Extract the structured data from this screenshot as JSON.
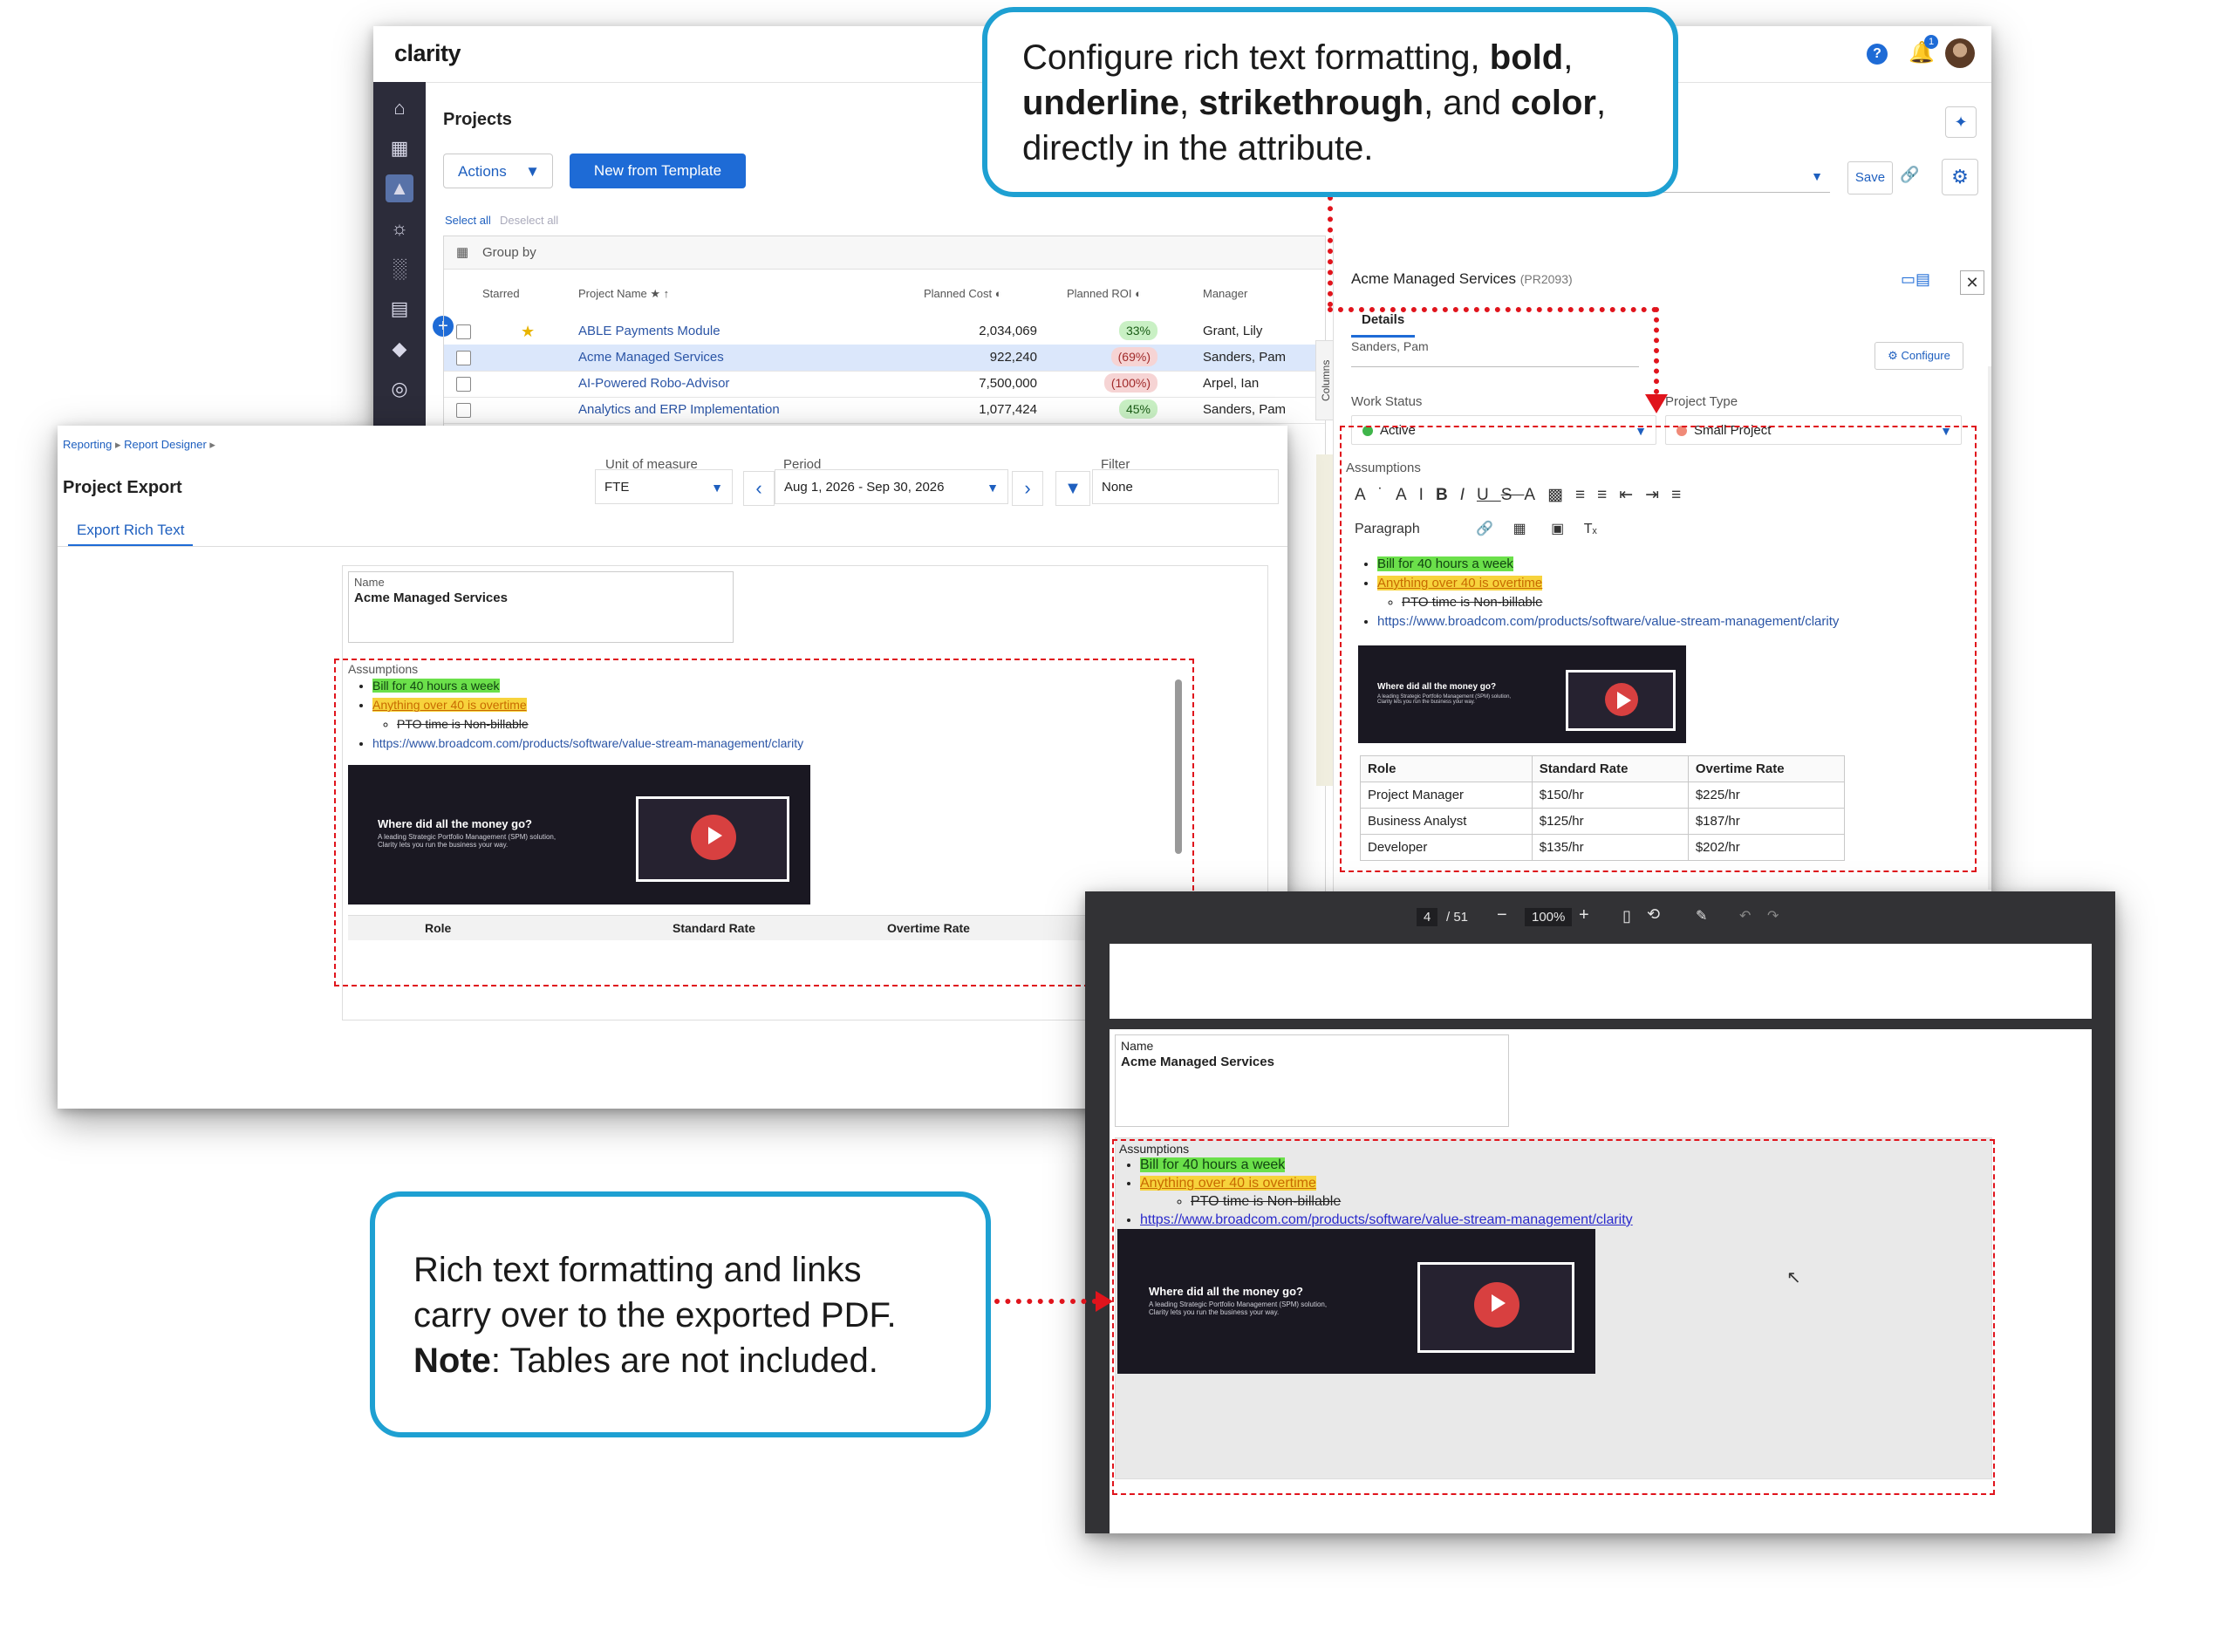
{
  "clarity": {
    "logo": "clarity",
    "page_title": "Projects",
    "actions_label": "Actions",
    "new_from_template_label": "New from Template",
    "select_all": "Select all",
    "deselect_all": "Deselect all",
    "group_by": "Group by",
    "columns_tab": "Columns",
    "save_label": "Save",
    "notification_count": "1",
    "headers": {
      "starred": "Starred",
      "project_name": "Project Name",
      "planned_cost": "Planned Cost",
      "planned_roi": "Planned ROI",
      "manager": "Manager"
    },
    "rows": [
      {
        "starred": true,
        "name": "ABLE Payments Module",
        "cost": "2,034,069",
        "roi": "33%",
        "roi_status": "good",
        "manager": "Grant, Lily"
      },
      {
        "starred": false,
        "name": "Acme Managed Services",
        "cost": "922,240",
        "roi": "(69%)",
        "roi_status": "bad",
        "manager": "Sanders, Pam"
      },
      {
        "starred": false,
        "name": "AI-Powered Robo-Advisor",
        "cost": "7,500,000",
        "roi": "(100%)",
        "roi_status": "bad",
        "manager": "Arpel, Ian"
      },
      {
        "starred": false,
        "name": "Analytics and ERP Implementation",
        "cost": "1,077,424",
        "roi": "45%",
        "roi_status": "good",
        "manager": "Sanders, Pam"
      }
    ],
    "detail": {
      "title": "Acme Managed Services",
      "code": "(PR2093)",
      "tab": "Details",
      "configure": "Configure",
      "truncated_value": "Sanders, Pam",
      "work_status_label": "Work Status",
      "work_status_value": "Active",
      "project_type_label": "Project Type",
      "project_type_value": "Small Project",
      "assumptions_label": "Assumptions",
      "paragraph_label": "Paragraph"
    }
  },
  "rich_text": {
    "item1": "Bill for 40 hours a week",
    "item2": "Anything over 40 is overtime",
    "sub_item": "PTO time is Non-billable",
    "link": "https://www.broadcom.com/products/software/value-stream-management/clarity",
    "video_title": "Where did all the money go?",
    "video_subtitle": "A leading Strategic Portfolio Management (SPM) solution, Clarity lets you run the business your way.",
    "table_headers": [
      "Role",
      "Standard Rate",
      "Overtime Rate"
    ],
    "table_rows": [
      [
        "Project Manager",
        "$150/hr",
        "$225/hr"
      ],
      [
        "Business Analyst",
        "$125/hr",
        "$187/hr"
      ],
      [
        "Developer",
        "$135/hr",
        "$202/hr"
      ]
    ]
  },
  "report": {
    "breadcrumb": [
      "Reporting",
      "Report Designer"
    ],
    "title": "Project Export",
    "tab": "Export Rich Text",
    "unit_label": "Unit of measure",
    "unit_value": "FTE",
    "period_label": "Period",
    "period_value": "Aug 1, 2026 - Sep 30, 2026",
    "filter_label": "Filter",
    "filter_value": "None",
    "name_label": "Name",
    "name_value": "Acme Managed Services",
    "assumptions_label": "Assumptions"
  },
  "pdf": {
    "page_current": "4",
    "page_total": "/ 51",
    "zoom": "100%",
    "name_label": "Name",
    "name_value": "Acme Managed Services",
    "assumptions_label": "Assumptions"
  },
  "callouts": {
    "top_pre": "Configure rich text formatting, ",
    "top_bold1": "bold",
    "top_sep1": ",",
    "top_bold2": "underline",
    "top_sep2": ", ",
    "top_bold3": "strikethrough",
    "top_sep3": ", and ",
    "top_bold4": "color",
    "top_sep4": ",",
    "top_post": "directly in the attribute.",
    "bottom_line1": "Rich text formatting and links",
    "bottom_line2": "carry over to the exported PDF.",
    "bottom_note_bold": "Note",
    "bottom_note_rest": ": Tables are not included."
  },
  "colors": {
    "accent": "#1e6bd6",
    "callout_border": "#1ea0d2",
    "annotation_red": "#e0141c",
    "highlight_green": "#6be04a",
    "highlight_yellow": "#f7d33c"
  }
}
